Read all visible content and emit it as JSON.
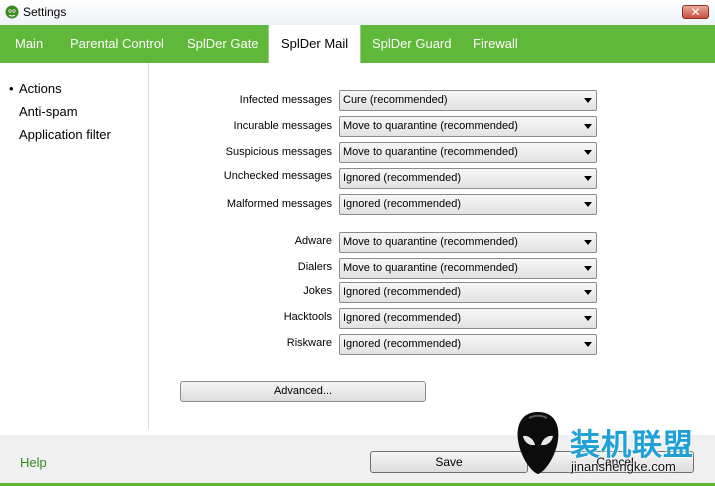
{
  "window": {
    "title": "Settings",
    "close": "✕"
  },
  "tabs": [
    {
      "label": "Main"
    },
    {
      "label": "Parental Control"
    },
    {
      "label": "SplDer Gate"
    },
    {
      "label": "SplDer Mail"
    },
    {
      "label": "SplDer Guard"
    },
    {
      "label": "Firewall"
    }
  ],
  "sidebar": {
    "items": [
      {
        "label": "Actions",
        "selected": true,
        "bullet": "•"
      },
      {
        "label": "Anti-spam"
      },
      {
        "label": "Application filter"
      }
    ]
  },
  "actions": [
    {
      "label": "Infected messages",
      "value": "Cure (recommended)"
    },
    {
      "label": "Incurable messages",
      "value": "Move to quarantine (recommended)"
    },
    {
      "label": "Suspicious messages",
      "value": "Move to quarantine (recommended)"
    },
    {
      "label": "Unchecked messages",
      "value": "Ignored (recommended)"
    },
    {
      "label": "Malformed messages",
      "value": "Ignored (recommended)"
    },
    {
      "label": "Adware",
      "value": "Move to quarantine (recommended)"
    },
    {
      "label": "Dialers",
      "value": "Move to quarantine (recommended)"
    },
    {
      "label": "Jokes",
      "value": "Ignored (recommended)"
    },
    {
      "label": "Hacktools",
      "value": "Ignored (recommended)"
    },
    {
      "label": "Riskware",
      "value": "Ignored (recommended)"
    }
  ],
  "advanced_label": "Advanced...",
  "footer": {
    "help": "Help",
    "save": "Save",
    "cancel": "Cancel"
  },
  "watermark": {
    "text_cn": "装机联盟",
    "url": "jinanshengke.com"
  },
  "colors": {
    "accent": "#5fb839",
    "help_link": "#2f8a1e",
    "watermark": "#1fa1d6"
  }
}
